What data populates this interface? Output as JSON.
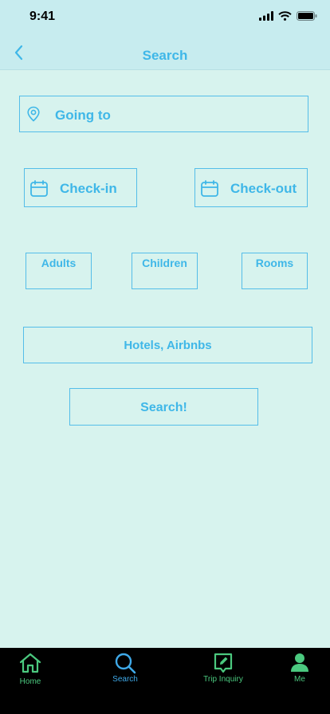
{
  "status_bar": {
    "time": "9:41"
  },
  "nav": {
    "title": "Search"
  },
  "form": {
    "destination_placeholder": "Going to",
    "check_in_label": "Check-in",
    "check_out_label": "Check-out",
    "adults_label": "Adults",
    "children_label": "Children",
    "rooms_label": "Rooms",
    "property_type_label": "Hotels, Airbnbs",
    "search_button_label": "Search!"
  },
  "tabs": [
    {
      "label": "Home",
      "icon": "home-icon"
    },
    {
      "label": "Search",
      "icon": "search-icon",
      "active": true
    },
    {
      "label": "Trip Inquiry",
      "icon": "edit-message-icon"
    },
    {
      "label": "Me",
      "icon": "user-icon"
    }
  ],
  "colors": {
    "accent": "#3fb7e8",
    "background": "#d7f3ee",
    "header": "#c7ecef",
    "tab_active": "#3fa9e8",
    "tab_inactive": "#4bc97f"
  }
}
